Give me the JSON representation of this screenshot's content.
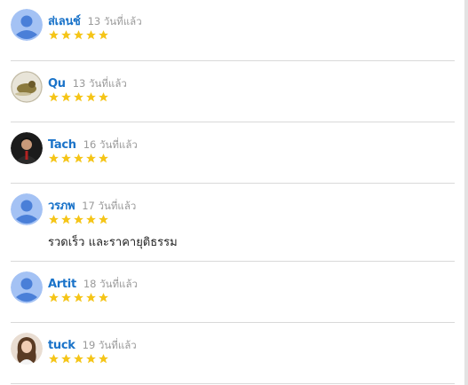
{
  "colors": {
    "name": "#1a73c9",
    "time": "#9a9a9a",
    "star": "#f5c518",
    "divider": "#d9d9d9",
    "avatar_default_bg": "#a4c2f4",
    "avatar_default_fg": "#4a7fd8"
  },
  "reviews": [
    {
      "name": "ส่เลนช์",
      "time": "13 วันที่แล้ว",
      "rating": 5,
      "avatar": "default-person-icon",
      "comment": ""
    },
    {
      "name": "Qu",
      "time": "13 วันที่แล้ว",
      "rating": 5,
      "avatar": "photo-avatar-bird",
      "comment": ""
    },
    {
      "name": "Tach",
      "time": "16 วันที่แล้ว",
      "rating": 5,
      "avatar": "photo-avatar-man",
      "comment": ""
    },
    {
      "name": "วรภพ",
      "time": "17 วันที่แล้ว",
      "rating": 5,
      "avatar": "default-person-icon",
      "comment": "รวดเร็ว และราคายุติธรรม"
    },
    {
      "name": "Artit",
      "time": "18 วันที่แล้ว",
      "rating": 5,
      "avatar": "default-person-icon",
      "comment": ""
    },
    {
      "name": "tuck",
      "time": "19 วันที่แล้ว",
      "rating": 5,
      "avatar": "photo-avatar-woman",
      "comment": ""
    }
  ]
}
